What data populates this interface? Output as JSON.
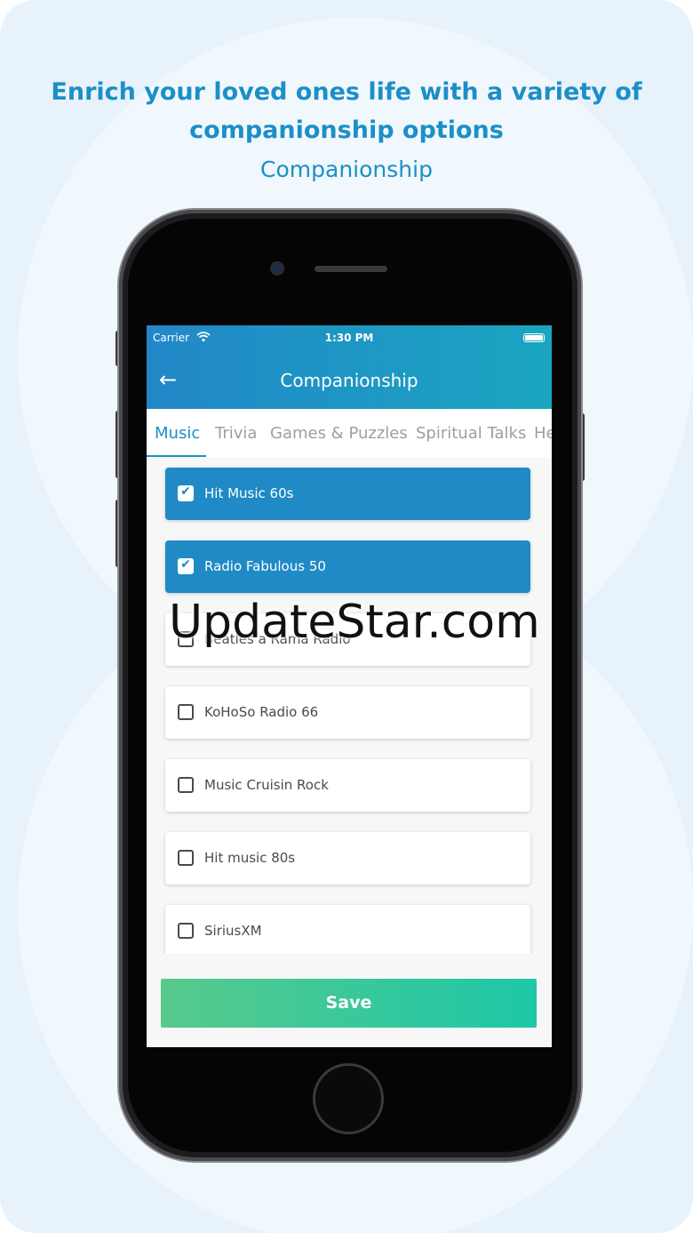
{
  "promo": {
    "headline": "Enrich your loved ones life with a variety of companionship options",
    "subheadline": "Companionship"
  },
  "statusbar": {
    "carrier": "Carrier",
    "time": "1:30 PM"
  },
  "appbar": {
    "back_glyph": "←",
    "title": "Companionship"
  },
  "tabs": [
    {
      "label": "Music",
      "active": true
    },
    {
      "label": "Trivia",
      "active": false
    },
    {
      "label": "Games & Puzzles",
      "active": false
    },
    {
      "label": "Spiritual Talks",
      "active": false
    },
    {
      "label": "He",
      "active": false
    }
  ],
  "items": [
    {
      "label": "Hit Music 60s",
      "checked": true
    },
    {
      "label": "Radio Fabulous 50",
      "checked": true
    },
    {
      "label": "Beatles a Rama Radio",
      "checked": false
    },
    {
      "label": "KoHoSo Radio 66",
      "checked": false
    },
    {
      "label": "Music Cruisin Rock",
      "checked": false
    },
    {
      "label": "Hit music 80s",
      "checked": false
    },
    {
      "label": "SiriusXM",
      "checked": false
    }
  ],
  "check_glyph": "✔",
  "save_label": "Save",
  "watermark": "UpdateStar.com",
  "colors": {
    "accent": "#1c8fc7",
    "selected_item": "#1f8ac6",
    "save_gradient_start": "#57c98c",
    "save_gradient_end": "#1ec8a8"
  },
  "icons": {
    "back": "arrow-left-icon",
    "wifi": "wifi-icon",
    "battery": "battery-icon",
    "checkbox": "checkbox-icon"
  }
}
